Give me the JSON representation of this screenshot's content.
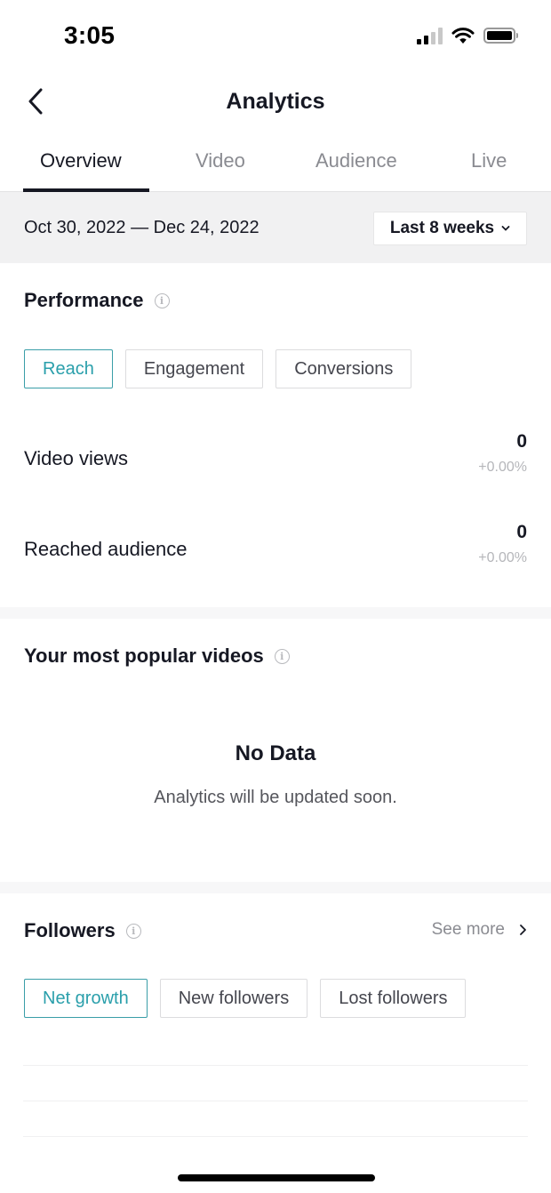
{
  "status_bar": {
    "time": "3:05",
    "icons": [
      "cellular-signal-icon",
      "wifi-icon",
      "battery-icon"
    ],
    "signal_bars_active": 2,
    "signal_bars_total": 4
  },
  "nav": {
    "back_icon": "chevron-left-icon",
    "title": "Analytics"
  },
  "tabs": [
    {
      "label": "Overview",
      "active": true
    },
    {
      "label": "Video",
      "active": false
    },
    {
      "label": "Audience",
      "active": false
    },
    {
      "label": "Live",
      "active": false
    }
  ],
  "date_bar": {
    "range_text": "Oct 30, 2022 — Dec 24, 2022",
    "period_select": {
      "selected": "Last 8 weeks",
      "icon": "chevron-down-icon"
    }
  },
  "performance": {
    "title": "Performance",
    "info_icon": "info-icon",
    "chips": [
      {
        "label": "Reach",
        "active": true
      },
      {
        "label": "Engagement",
        "active": false
      },
      {
        "label": "Conversions",
        "active": false
      }
    ],
    "metrics": [
      {
        "label": "Video views",
        "value": "0",
        "change": "+0.00%"
      },
      {
        "label": "Reached audience",
        "value": "0",
        "change": "+0.00%"
      }
    ]
  },
  "popular_videos": {
    "title": "Your most popular videos",
    "info_icon": "info-icon",
    "empty_title": "No Data",
    "empty_subtitle": "Analytics will be updated soon."
  },
  "followers": {
    "title": "Followers",
    "info_icon": "info-icon",
    "see_more_label": "See more",
    "see_more_icon": "chevron-right-icon",
    "chips": [
      {
        "label": "Net growth",
        "active": true
      },
      {
        "label": "New followers",
        "active": false
      },
      {
        "label": "Lost followers",
        "active": false
      }
    ]
  },
  "colors": {
    "accent": "#2a9fab",
    "text_primary": "#161823",
    "text_secondary": "#8a8b91",
    "band_background": "#f1f1f2"
  }
}
